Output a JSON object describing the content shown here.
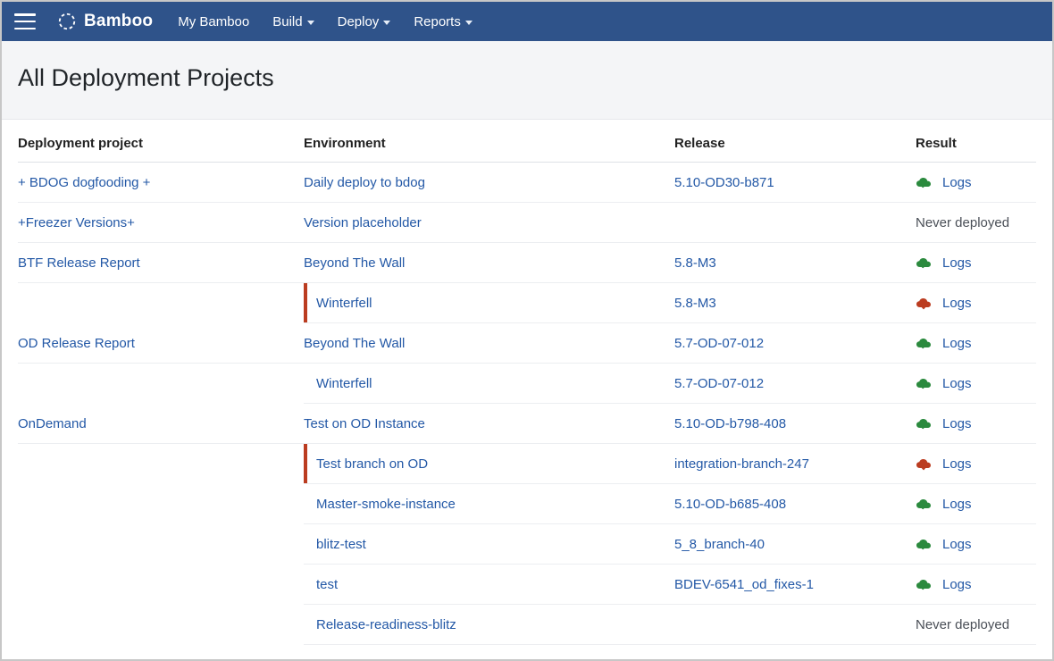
{
  "brand": "Bamboo",
  "nav": {
    "my_bamboo": "My Bamboo",
    "build": "Build",
    "deploy": "Deploy",
    "reports": "Reports"
  },
  "page_title": "All Deployment Projects",
  "columns": {
    "project": "Deployment project",
    "environment": "Environment",
    "release": "Release",
    "result": "Result"
  },
  "logs_label": "Logs",
  "never_deployed_label": "Never deployed",
  "status_colors": {
    "success": "#2b8a3e",
    "failed": "#bb3c20"
  },
  "projects": [
    {
      "name": "+ BDOG dogfooding +",
      "envs": [
        {
          "name": "Daily deploy to bdog",
          "release": "5.10-OD30-b871",
          "status": "success"
        }
      ]
    },
    {
      "name": "+Freezer Versions+",
      "envs": [
        {
          "name": "Version placeholder",
          "release": "",
          "status": "never"
        }
      ]
    },
    {
      "name": "BTF Release Report",
      "envs": [
        {
          "name": "Beyond The Wall",
          "release": "5.8-M3",
          "status": "success"
        },
        {
          "name": "Winterfell",
          "release": "5.8-M3",
          "status": "failed"
        }
      ]
    },
    {
      "name": "OD Release Report",
      "envs": [
        {
          "name": "Beyond The Wall",
          "release": "5.7-OD-07-012",
          "status": "success"
        },
        {
          "name": "Winterfell",
          "release": "5.7-OD-07-012",
          "status": "success"
        }
      ]
    },
    {
      "name": "OnDemand",
      "envs": [
        {
          "name": "Test on OD Instance",
          "release": "5.10-OD-b798-408",
          "status": "success"
        },
        {
          "name": "Test branch on OD",
          "release": "integration-branch-247",
          "status": "failed"
        },
        {
          "name": "Master-smoke-instance",
          "release": "5.10-OD-b685-408",
          "status": "success"
        },
        {
          "name": "blitz-test",
          "release": "5_8_branch-40",
          "status": "success"
        },
        {
          "name": "test",
          "release": "BDEV-6541_od_fixes-1",
          "status": "success"
        },
        {
          "name": "Release-readiness-blitz",
          "release": "",
          "status": "never"
        }
      ]
    }
  ]
}
